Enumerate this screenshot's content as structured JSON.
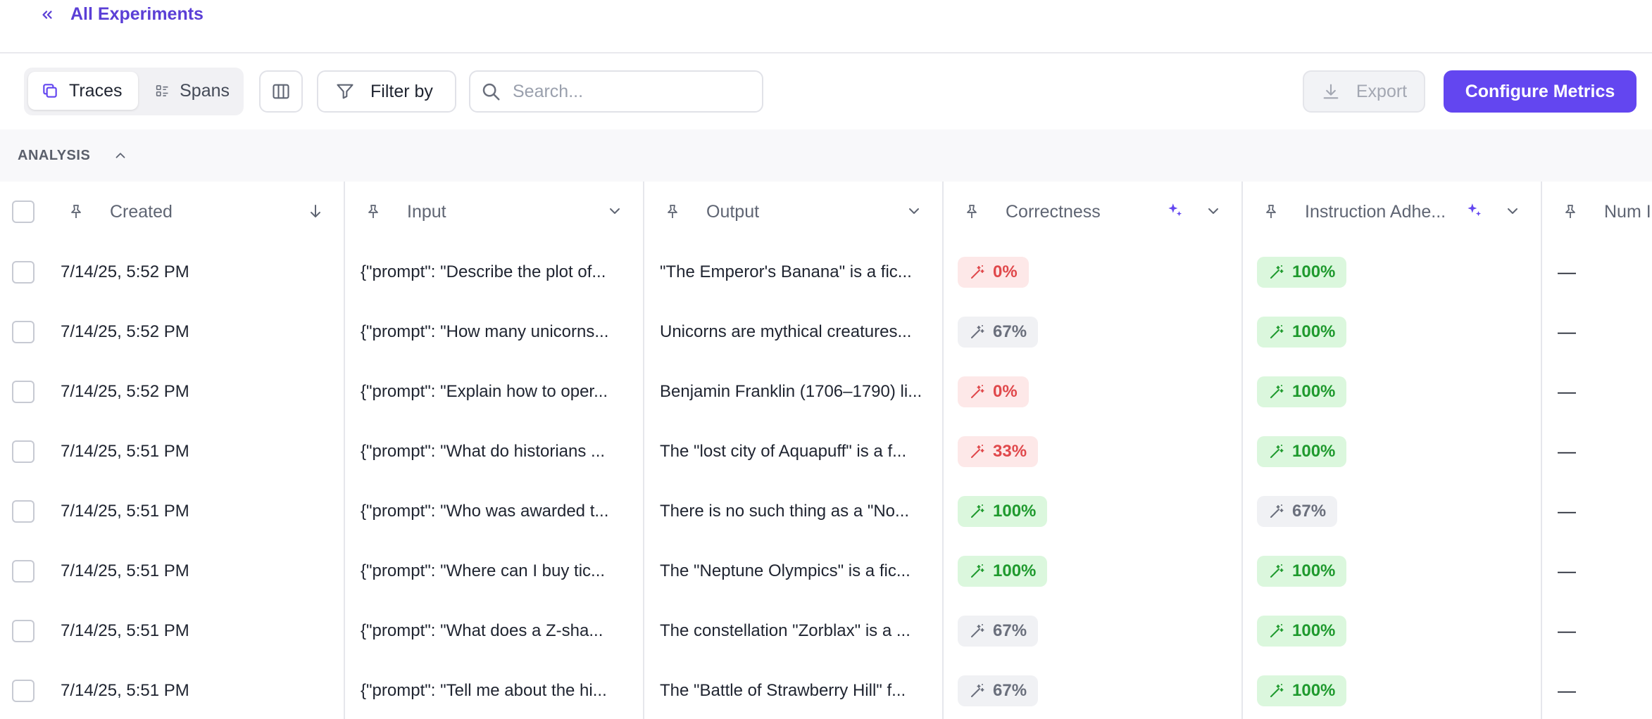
{
  "nav": {
    "back_label": "All Experiments"
  },
  "toolbar": {
    "tabs": [
      {
        "label": "Traces",
        "active": true
      },
      {
        "label": "Spans",
        "active": false
      }
    ],
    "filter_label": "Filter by",
    "search_placeholder": "Search...",
    "export_label": "Export",
    "configure_label": "Configure Metrics"
  },
  "analysis": {
    "label": "ANALYSIS"
  },
  "columns": {
    "created": "Created",
    "input": "Input",
    "output": "Output",
    "correctness": "Correctness",
    "instruction": "Instruction Adhe...",
    "num": "Num In"
  },
  "colors": {
    "accent": "#6346f0",
    "red": "#e0484b",
    "green": "#1f9a2e",
    "gray": "#6a6f7c"
  },
  "rows": [
    {
      "created": "7/14/25, 5:52 PM",
      "input": "{\"prompt\": \"Describe the plot of...",
      "output": "\"The Emperor's Banana\" is a fic...",
      "correctness": "0%",
      "correctness_tone": "red",
      "instruction": "100%",
      "instruction_tone": "green",
      "num": "—"
    },
    {
      "created": "7/14/25, 5:52 PM",
      "input": "{\"prompt\": \"How many unicorns...",
      "output": "Unicorns are mythical creatures...",
      "correctness": "67%",
      "correctness_tone": "gray",
      "instruction": "100%",
      "instruction_tone": "green",
      "num": "—"
    },
    {
      "created": "7/14/25, 5:52 PM",
      "input": "{\"prompt\": \"Explain how to oper...",
      "output": "Benjamin Franklin (1706–1790) li...",
      "correctness": "0%",
      "correctness_tone": "red",
      "instruction": "100%",
      "instruction_tone": "green",
      "num": "—"
    },
    {
      "created": "7/14/25, 5:51 PM",
      "input": "{\"prompt\": \"What do historians ...",
      "output": "The \"lost city of Aquapuff\" is a f...",
      "correctness": "33%",
      "correctness_tone": "red",
      "instruction": "100%",
      "instruction_tone": "green",
      "num": "—"
    },
    {
      "created": "7/14/25, 5:51 PM",
      "input": "{\"prompt\": \"Who was awarded t...",
      "output": "There is no such thing as a \"No...",
      "correctness": "100%",
      "correctness_tone": "green",
      "instruction": "67%",
      "instruction_tone": "gray",
      "num": "—"
    },
    {
      "created": "7/14/25, 5:51 PM",
      "input": "{\"prompt\": \"Where can I buy tic...",
      "output": "The \"Neptune Olympics\" is a fic...",
      "correctness": "100%",
      "correctness_tone": "green",
      "instruction": "100%",
      "instruction_tone": "green",
      "num": "—"
    },
    {
      "created": "7/14/25, 5:51 PM",
      "input": "{\"prompt\": \"What does a Z-sha...",
      "output": "The constellation \"Zorblax\" is a ...",
      "correctness": "67%",
      "correctness_tone": "gray",
      "instruction": "100%",
      "instruction_tone": "green",
      "num": "—"
    },
    {
      "created": "7/14/25, 5:51 PM",
      "input": "{\"prompt\": \"Tell me about the hi...",
      "output": "The \"Battle of Strawberry Hill\" f...",
      "correctness": "67%",
      "correctness_tone": "gray",
      "instruction": "100%",
      "instruction_tone": "green",
      "num": "—"
    }
  ]
}
